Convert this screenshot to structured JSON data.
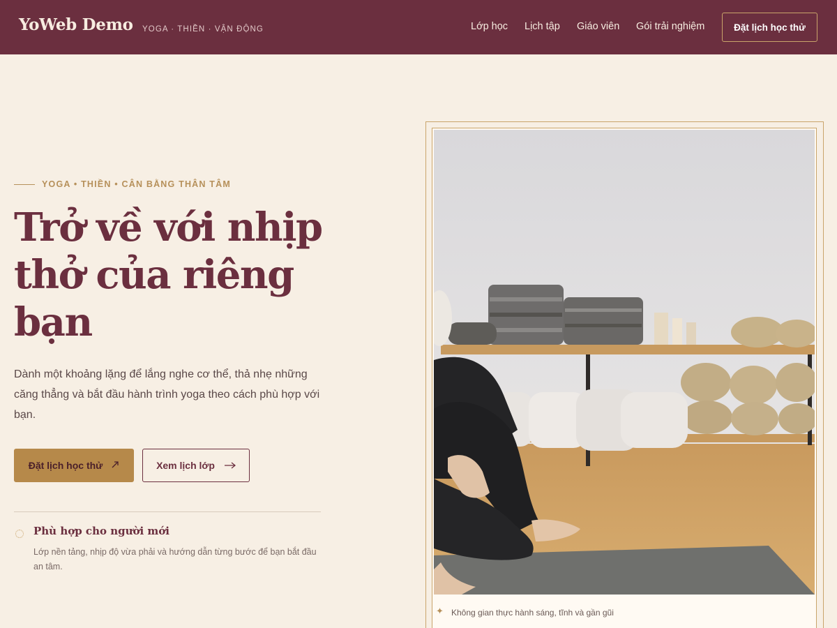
{
  "header": {
    "brand": "YoWeb Demo",
    "tagline": "YOGA · THIỀN · VẬN ĐỘNG",
    "nav": [
      "Lớp học",
      "Lịch tập",
      "Giáo viên",
      "Gói trải nghiệm"
    ],
    "cta": "Đặt lịch học thử"
  },
  "hero": {
    "eyebrow": "YOGA • THIỀN • CÂN BẰNG THÂN TÂM",
    "title": "Trở về với nhịp thở của riêng bạn",
    "description": "Dành một khoảng lặng để lắng nghe cơ thể, thả nhẹ những căng thẳng và bắt đầu hành trình yoga theo cách phù hợp với bạn.",
    "primary_button": "Đặt lịch học thử",
    "secondary_button": "Xem lịch lớp"
  },
  "feature": {
    "title": "Phù hợp cho người mới",
    "description": "Lớp nền tảng, nhịp độ vừa phải và hướng dẫn từng bước để bạn bắt đầu an tâm."
  },
  "image": {
    "caption": "Không gian thực hành sáng, tĩnh và gần gũi"
  },
  "icons": {
    "primary_arrow": "diagonal-arrow-icon",
    "secondary_arrow": "right-arrow-icon",
    "feature": "dotted-circle-icon",
    "caption": "sparkle-icon"
  },
  "colors": {
    "header_bg": "#6b2f3f",
    "page_bg": "#f7efe4",
    "accent_gold": "#b6894a",
    "title": "#6b2f3f"
  }
}
